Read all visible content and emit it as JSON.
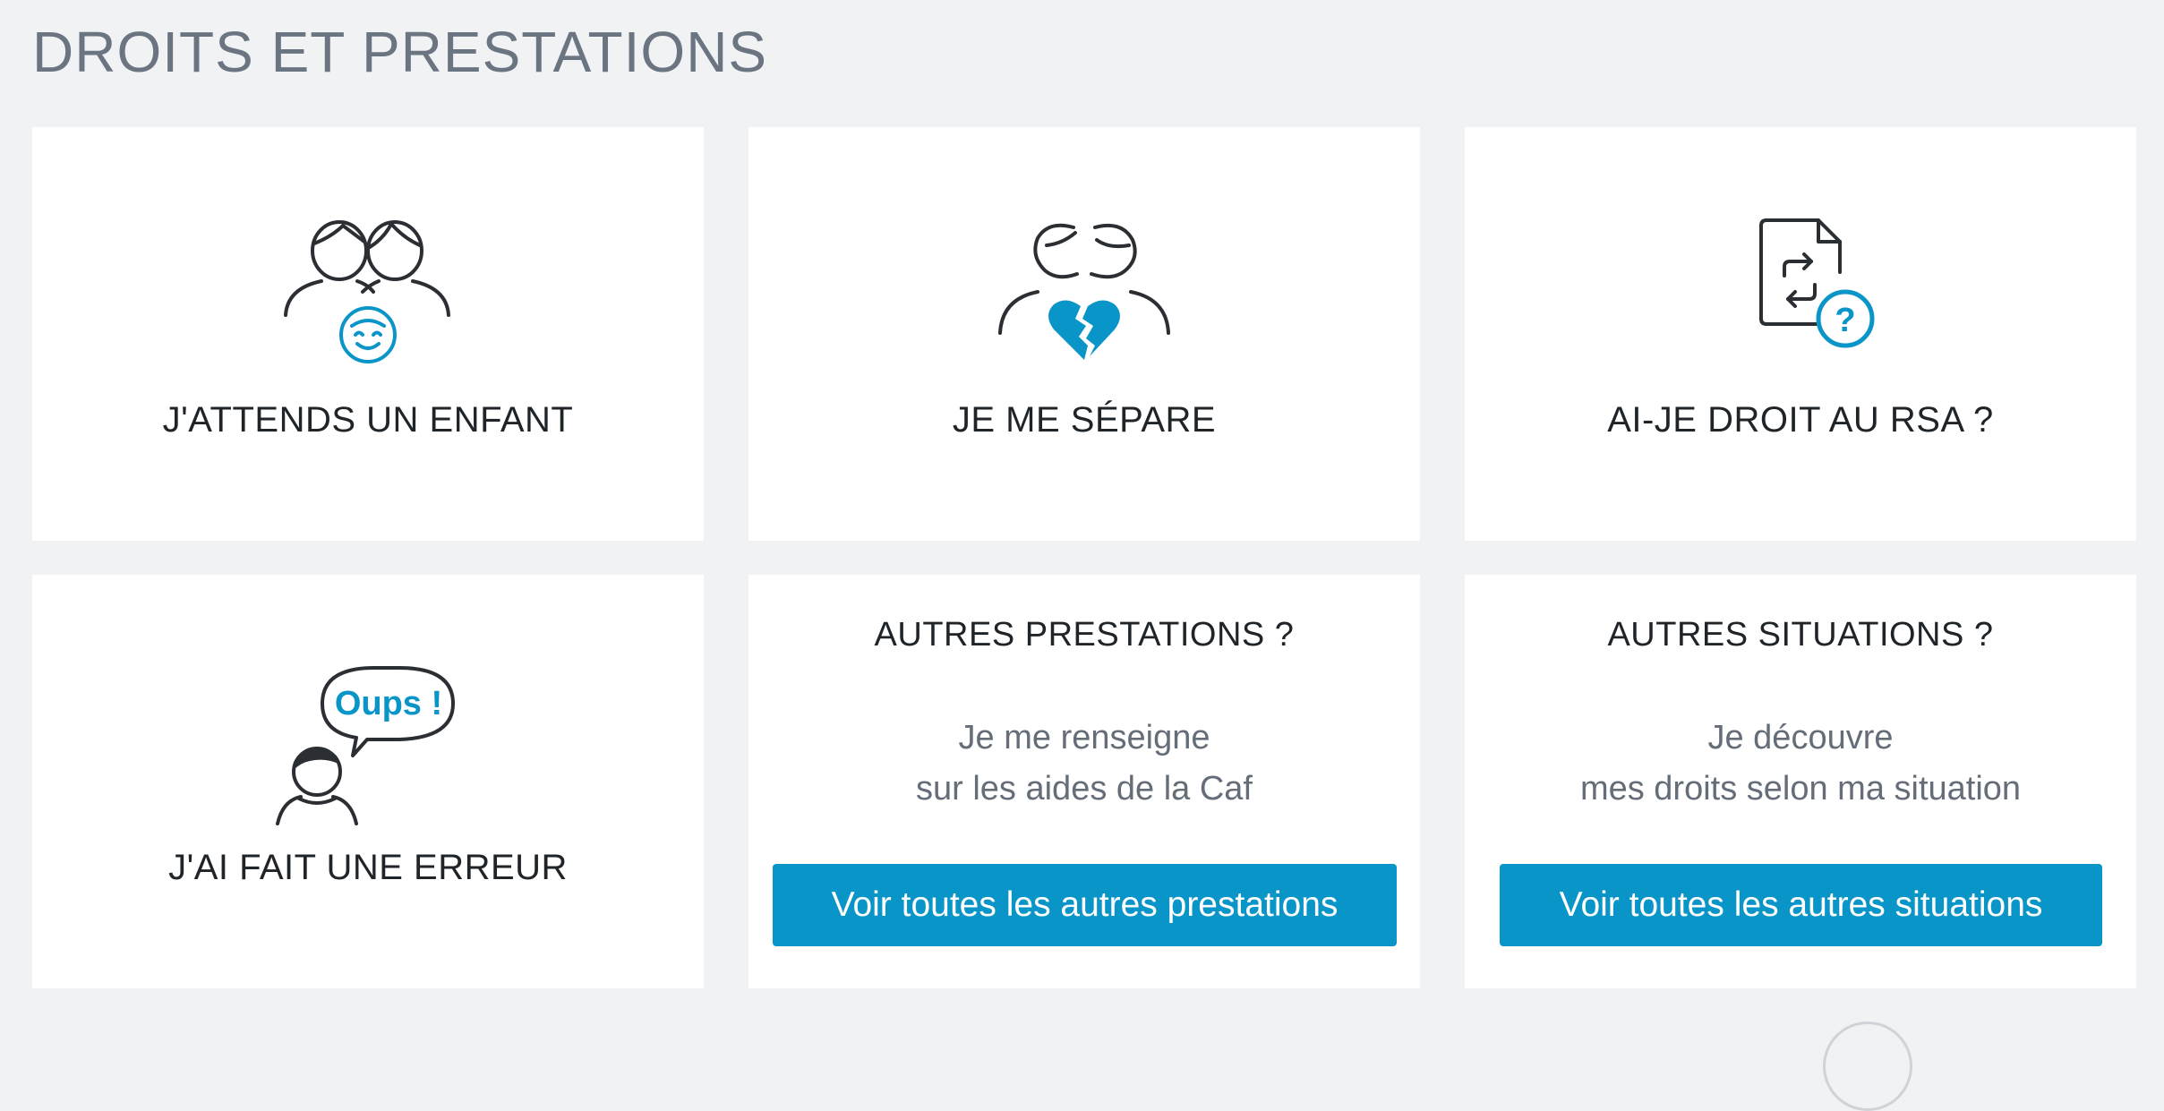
{
  "page": {
    "title": "DROITS ET PRESTATIONS"
  },
  "colors": {
    "background": "#f1f2f4",
    "card": "#ffffff",
    "accent": "#0a95c8",
    "icon_stroke": "#2b2f33",
    "title": "#6b7582"
  },
  "cards": [
    {
      "label": "J'ATTENDS UN ENFANT",
      "icon": "expecting-parents-icon"
    },
    {
      "label": "JE ME SÉPARE",
      "icon": "separation-broken-heart-icon"
    },
    {
      "label": "AI-JE DROIT AU RSA ?",
      "icon": "rsa-document-question-icon"
    },
    {
      "label": "J'AI FAIT UNE ERREUR",
      "icon": "oups-error-icon",
      "bubble_text": "Oups !"
    },
    {
      "heading": "AUTRES PRESTATIONS ?",
      "desc_line1": "Je me renseigne",
      "desc_line2": "sur les aides de la Caf",
      "button_label": "Voir toutes les autres prestations"
    },
    {
      "heading": "AUTRES SITUATIONS ?",
      "desc_line1": "Je découvre",
      "desc_line2": "mes droits selon ma situation",
      "button_label": "Voir toutes les autres situations"
    }
  ]
}
